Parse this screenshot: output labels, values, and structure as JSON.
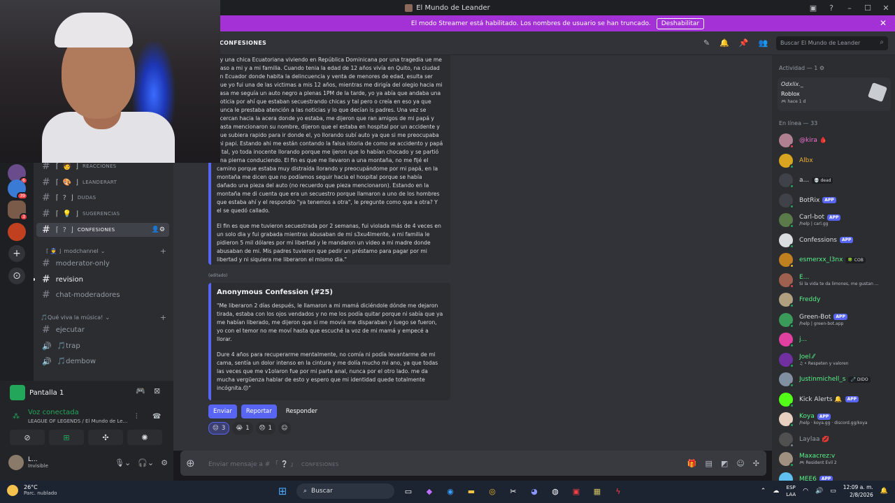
{
  "window": {
    "title": "El Mundo de Leander",
    "controls": [
      "▣",
      "?",
      "–",
      "☐",
      "✕"
    ]
  },
  "banner": {
    "text": "El modo Streamer está habilitado. Los nombres de usuario se han truncado.",
    "button": "Deshabilitar"
  },
  "header": {
    "channel": "CONFESIONES",
    "search_placeholder": "Buscar El Mundo de Leander"
  },
  "servers": [
    {
      "badge": "6",
      "color": "#6a4c8c"
    },
    {
      "badge": "39",
      "color": "#3a7bd5"
    },
    {
      "badge": "3",
      "color": "#7a5a48"
    },
    {
      "badge": "",
      "color": "#c04020"
    }
  ],
  "channels": [
    {
      "emoji": "🧑",
      "name": "REACCIONES"
    },
    {
      "emoji": "🎨",
      "name": "LEANDERART"
    },
    {
      "emoji": "?",
      "name": "DUDAS"
    },
    {
      "emoji": "💡",
      "name": "SUGERENCIAS"
    },
    {
      "emoji": "?",
      "name": "CONFESIONES"
    }
  ],
  "categories": {
    "mod": "modchannel",
    "music": "🎵Qué viva la música!"
  },
  "mod_channels": [
    "moderator-only",
    "revision",
    "chat-moderadores"
  ],
  "music_channels": [
    "ejecutar",
    "🎵trap",
    "🎵dembow"
  ],
  "voice_panel": {
    "title": "Pantalla 1",
    "status": "Voz conectada",
    "detail": "LEAGUE OF LEGENDS / El Mundo de Le...",
    "user_name": "L...",
    "user_status": "Invisible"
  },
  "message1": {
    "paragraphs": [
      "oy una chica Ecuatoriana viviendo en República Dominicana por una tragedia ue me paso a mi y a mi familia. Cuando tenia la edad de 12 años vivía en Quito, na ciudad en Ecuador donde habita la delincuencia y venta de menores de edad, esulta ser que yo fui una de las victimas a mis 12 años, mientras me dirigía del olegio hacia mi casa me seguía un auto negro a plenas 1PM de la tarde, yo ya abía que andaba una noticia por ahí que estaban secuestrando chicas y tal pero o creía en eso ya que nunca le prestaba atención a las noticias y lo que decían is padres. Una vez se acercan hacia la acera donde yo estaba, me dijeron que ran amigos de mi papá y hasta mencionaron su nombre, dijeron que el estaba en hospital por un accidente y que subiera rapido para ir donde el, yo llorando subí auto ya que si me preocupaba mi papi. Estando ahi me están contando la falsa istoria de como se accidento y papá y tal, yo toda inocente llorando porque me ijeron que lo habían chocado y se partió una pierna conduciendo. El fin es que me llevaron a una montaña, no me fijé el camino porque estaba muy distraída llorando y preocupándome por mi papá, en la montaña me dicen que no podíamos seguir hacia el hospital porque se había dañado una pieza del auto (no recuerdo que pieza mencionaron). Estando en la montaña me di cuenta que era un secuestro porque llamaron a uno de los hombres que estaba ahí y el respondio \"ya tenemos a otra\", le pregunte como que a otra? Y el se quedó callado.",
      "El fin es que me tuvieron secuestrada por 2 semanas, fui violada más de 4 veces en un solo dia y fui grabada mientras abusaban de mi s3xu4lmente, a mi familia le pidieron 5 mil dólares por mi libertad y le mandaron un video a mi madre donde abusaban de mi. Mis padres tuvieron que pedir un préstamo para pagar por mi libertad y ni siquiera me liberaron el mismo dia.\""
    ],
    "edited": "(editado)"
  },
  "message2": {
    "title": "Anonymous Confession (#25)",
    "paragraphs": [
      "\"Me liberaron 2 días después, le llamaron a mi mamá diciéndole dónde me dejaron tirada, estaba con los ojos vendados y no me los podía quitar porque ni sabía que ya me habían liberado, me dijeron que si me movía me disparaban y luego se fueron, yo con el temor no me moví hasta que escuché la voz de mi mamá y empecé a llorar.",
      "Dure 4 años para recuperarme mentalmente, no comía ni podía levantarme de mi cama, sentía un dolor intenso en la cintura y me dolía mucho mi ano, ya que todas las veces que me v1olaron fue por mi parte anal, nunca por el otro lado. me da mucha vergüenza hablar de esto y espero que mi identidad quede totalmente incógnita.😔\""
    ]
  },
  "buttons": {
    "send": "Enviar",
    "report": "Reportar",
    "reply": "Responder"
  },
  "reactions": [
    {
      "emoji": "😔",
      "count": "3"
    },
    {
      "emoji": "😭",
      "count": "1"
    },
    {
      "emoji": "😞",
      "count": "1"
    }
  ],
  "composer": {
    "placeholder": "Enviar mensaje a # 「 ❔ 」",
    "channel": "CONFESIONES"
  },
  "members": {
    "activity_header": "Actividad — 1",
    "activity": {
      "name": "Odxlix._",
      "game": "Roblox",
      "time": "🎮 hace 1 d"
    },
    "online_header": "En línea — 33",
    "list": [
      {
        "name": "@kira 🩸",
        "sub": "",
        "tag": "",
        "color": "#f472d0",
        "av": "#b08090",
        "status": "#f23f43"
      },
      {
        "name": "Albx",
        "sub": "",
        "tag": "",
        "color": "#f0b232",
        "av": "#d9a520",
        "status": "#23a55a"
      },
      {
        "name": "a...",
        "sub": "",
        "tag": "💀 dead",
        "color": "#dbdee1",
        "av": "#404249",
        "status": "#23a55a"
      },
      {
        "name": "BotRix",
        "sub": "",
        "tag": "APP",
        "color": "#dbdee1",
        "av": "#404249",
        "status": "#23a55a"
      },
      {
        "name": "Carl-bot",
        "sub": "/help | carl.gg",
        "tag": "APP",
        "color": "#dbdee1",
        "av": "#5a7a4a",
        "status": "#23a55a"
      },
      {
        "name": "Confessions",
        "sub": "",
        "tag": "APP",
        "color": "#dbdee1",
        "av": "#dbdee1",
        "status": "#23a55a"
      },
      {
        "name": "esmerxx_l3nx",
        "sub": "",
        "tag": "🍀 COB",
        "color": "#57f287",
        "av": "#c08020",
        "status": "#f0b232"
      },
      {
        "name": "E...",
        "sub": "Si la vida te da limones, me gustan ...",
        "tag": "",
        "color": "#57f287",
        "av": "#a06050",
        "status": "#f23f43"
      },
      {
        "name": "Freddy",
        "sub": "",
        "tag": "",
        "color": "#57f287",
        "av": "#b0a080",
        "status": "#23a55a"
      },
      {
        "name": "Green-Bot",
        "sub": "/help | green-bot.app",
        "tag": "APP",
        "color": "#dbdee1",
        "av": "#3a9a5a",
        "status": "#23a55a"
      },
      {
        "name": "j...",
        "sub": "",
        "tag": "",
        "color": "#57f287",
        "av": "#e040a0",
        "status": "#23a55a"
      },
      {
        "name": "Joel ⁄⁄",
        "sub": "♫ • Respeten y valoren",
        "tag": "",
        "color": "#57f287",
        "av": "#7030a0",
        "status": "#23a55a"
      },
      {
        "name": "Justinmichell_s",
        "sub": "",
        "tag": "🧷 DIDO",
        "color": "#57f287",
        "av": "#8090a0",
        "status": "#23a55a"
      },
      {
        "name": "Kick Alerts 🔔",
        "sub": "",
        "tag": "APP",
        "color": "#dbdee1",
        "av": "#53fc18",
        "status": "#23a55a"
      },
      {
        "name": "Koya",
        "sub": "/help · koya.gg · discord.gg/koya",
        "tag": "APP",
        "color": "#57f287",
        "av": "#e8d0c0",
        "status": "#23a55a"
      },
      {
        "name": "Laylaa 💋",
        "sub": "",
        "tag": "",
        "color": "#949ba4",
        "av": "#505050",
        "status": "#80848e"
      },
      {
        "name": "Maxacrez:v",
        "sub": "🎮 Resident Evil 2",
        "tag": "",
        "color": "#57f287",
        "av": "#a09080",
        "status": "#23a55a"
      },
      {
        "name": "MEE6",
        "sub": "",
        "tag": "APP",
        "color": "#57f287",
        "av": "#60c0f0",
        "status": "#23a55a"
      }
    ]
  },
  "taskbar": {
    "temp": "26°C",
    "weather": "Parc. nublado",
    "search": "Buscar",
    "lang1": "ESP",
    "lang2": "LAA",
    "time": "12:09 a. m.",
    "date": "2/8/2026"
  }
}
